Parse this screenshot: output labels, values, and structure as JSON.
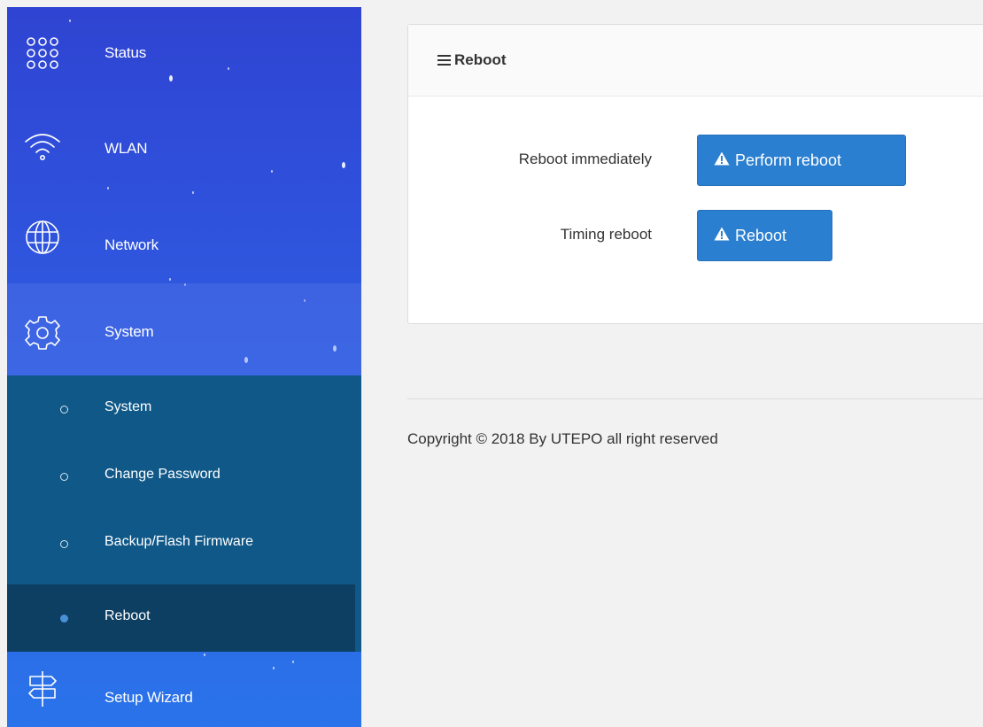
{
  "sidebar": {
    "status_label": "Status",
    "wlan_label": "WLAN",
    "network_label": "Network",
    "system_label": "System",
    "submenu": {
      "system": "System",
      "change_password": "Change Password",
      "backup_flash_firmware": "Backup/Flash Firmware",
      "reboot": "Reboot"
    },
    "setup_wizard_label": "Setup Wizard"
  },
  "panel": {
    "title": "Reboot",
    "reboot_immediately_label": "Reboot immediately",
    "perform_reboot_button": "Perform reboot",
    "timing_reboot_label": "Timing reboot",
    "reboot_button": "Reboot"
  },
  "footer": {
    "copyright": "Copyright © 2018 By UTEPO all right reserved"
  },
  "colors": {
    "sidebar_gradient_top": "#2f44d2",
    "sidebar_gradient_bottom": "#2a73ea",
    "submenu_bg": "#0f5888",
    "submenu_active_bg": "#0d3f63",
    "button_primary": "#2b7fd0"
  },
  "icons": {
    "status": "grid-circles-icon",
    "wlan": "wifi-icon",
    "network": "globe-icon",
    "system": "gear-icon",
    "setup_wizard": "signpost-icon",
    "warning": "warning-icon",
    "menu": "hamburger-icon"
  }
}
